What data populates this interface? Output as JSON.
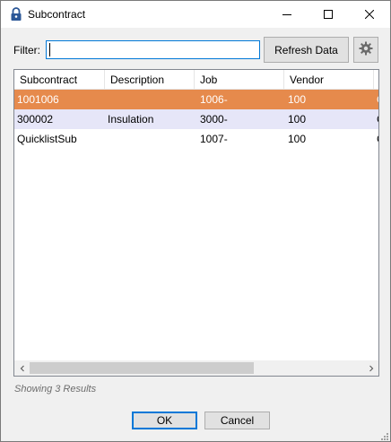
{
  "window": {
    "title": "Subcontract",
    "icon": "padlock-icon"
  },
  "filter": {
    "label": "Filter:",
    "value": "",
    "placeholder": ""
  },
  "toolbar": {
    "refresh_label": "Refresh Data",
    "settings_icon": "gear-icon"
  },
  "grid": {
    "columns": [
      "Subcontract",
      "Description",
      "Job",
      "Vendor",
      ""
    ],
    "rows": [
      {
        "subcontract": "1001006",
        "description": "",
        "job": "1006-",
        "vendor": "100",
        "extra": "C",
        "selected": true
      },
      {
        "subcontract": "300002",
        "description": "Insulation",
        "job": "3000-",
        "vendor": "100",
        "extra": "C",
        "selected": false
      },
      {
        "subcontract": "QuicklistSub",
        "description": "",
        "job": "1007-",
        "vendor": "100",
        "extra": "C",
        "selected": false
      }
    ]
  },
  "status": {
    "text": "Showing 3 Results"
  },
  "buttons": {
    "ok_label": "OK",
    "cancel_label": "Cancel"
  },
  "colors": {
    "selected_row": "#e68a4c",
    "alt_row": "#e6e6f8",
    "accent": "#0078d7"
  }
}
